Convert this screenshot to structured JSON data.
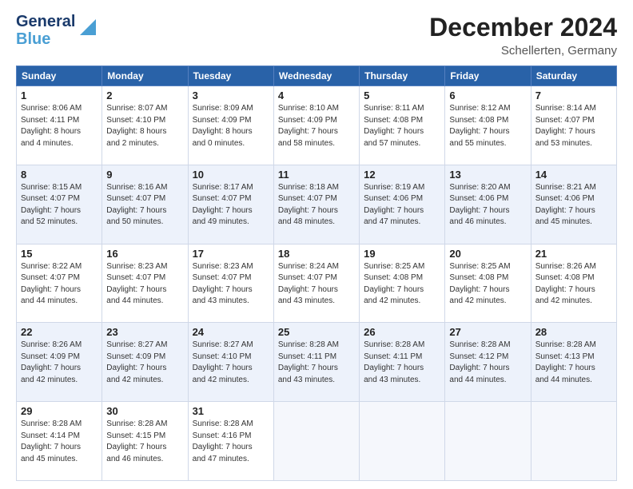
{
  "logo": {
    "line1": "General",
    "line2": "Blue"
  },
  "title": "December 2024",
  "subtitle": "Schellerten, Germany",
  "days_of_week": [
    "Sunday",
    "Monday",
    "Tuesday",
    "Wednesday",
    "Thursday",
    "Friday",
    "Saturday"
  ],
  "weeks": [
    [
      {
        "day": "1",
        "info": "Sunrise: 8:06 AM\nSunset: 4:11 PM\nDaylight: 8 hours\nand 4 minutes."
      },
      {
        "day": "2",
        "info": "Sunrise: 8:07 AM\nSunset: 4:10 PM\nDaylight: 8 hours\nand 2 minutes."
      },
      {
        "day": "3",
        "info": "Sunrise: 8:09 AM\nSunset: 4:09 PM\nDaylight: 8 hours\nand 0 minutes."
      },
      {
        "day": "4",
        "info": "Sunrise: 8:10 AM\nSunset: 4:09 PM\nDaylight: 7 hours\nand 58 minutes."
      },
      {
        "day": "5",
        "info": "Sunrise: 8:11 AM\nSunset: 4:08 PM\nDaylight: 7 hours\nand 57 minutes."
      },
      {
        "day": "6",
        "info": "Sunrise: 8:12 AM\nSunset: 4:08 PM\nDaylight: 7 hours\nand 55 minutes."
      },
      {
        "day": "7",
        "info": "Sunrise: 8:14 AM\nSunset: 4:07 PM\nDaylight: 7 hours\nand 53 minutes."
      }
    ],
    [
      {
        "day": "8",
        "info": "Sunrise: 8:15 AM\nSunset: 4:07 PM\nDaylight: 7 hours\nand 52 minutes."
      },
      {
        "day": "9",
        "info": "Sunrise: 8:16 AM\nSunset: 4:07 PM\nDaylight: 7 hours\nand 50 minutes."
      },
      {
        "day": "10",
        "info": "Sunrise: 8:17 AM\nSunset: 4:07 PM\nDaylight: 7 hours\nand 49 minutes."
      },
      {
        "day": "11",
        "info": "Sunrise: 8:18 AM\nSunset: 4:07 PM\nDaylight: 7 hours\nand 48 minutes."
      },
      {
        "day": "12",
        "info": "Sunrise: 8:19 AM\nSunset: 4:06 PM\nDaylight: 7 hours\nand 47 minutes."
      },
      {
        "day": "13",
        "info": "Sunrise: 8:20 AM\nSunset: 4:06 PM\nDaylight: 7 hours\nand 46 minutes."
      },
      {
        "day": "14",
        "info": "Sunrise: 8:21 AM\nSunset: 4:06 PM\nDaylight: 7 hours\nand 45 minutes."
      }
    ],
    [
      {
        "day": "15",
        "info": "Sunrise: 8:22 AM\nSunset: 4:07 PM\nDaylight: 7 hours\nand 44 minutes."
      },
      {
        "day": "16",
        "info": "Sunrise: 8:23 AM\nSunset: 4:07 PM\nDaylight: 7 hours\nand 44 minutes."
      },
      {
        "day": "17",
        "info": "Sunrise: 8:23 AM\nSunset: 4:07 PM\nDaylight: 7 hours\nand 43 minutes."
      },
      {
        "day": "18",
        "info": "Sunrise: 8:24 AM\nSunset: 4:07 PM\nDaylight: 7 hours\nand 43 minutes."
      },
      {
        "day": "19",
        "info": "Sunrise: 8:25 AM\nSunset: 4:08 PM\nDaylight: 7 hours\nand 42 minutes."
      },
      {
        "day": "20",
        "info": "Sunrise: 8:25 AM\nSunset: 4:08 PM\nDaylight: 7 hours\nand 42 minutes."
      },
      {
        "day": "21",
        "info": "Sunrise: 8:26 AM\nSunset: 4:08 PM\nDaylight: 7 hours\nand 42 minutes."
      }
    ],
    [
      {
        "day": "22",
        "info": "Sunrise: 8:26 AM\nSunset: 4:09 PM\nDaylight: 7 hours\nand 42 minutes."
      },
      {
        "day": "23",
        "info": "Sunrise: 8:27 AM\nSunset: 4:09 PM\nDaylight: 7 hours\nand 42 minutes."
      },
      {
        "day": "24",
        "info": "Sunrise: 8:27 AM\nSunset: 4:10 PM\nDaylight: 7 hours\nand 42 minutes."
      },
      {
        "day": "25",
        "info": "Sunrise: 8:28 AM\nSunset: 4:11 PM\nDaylight: 7 hours\nand 43 minutes."
      },
      {
        "day": "26",
        "info": "Sunrise: 8:28 AM\nSunset: 4:11 PM\nDaylight: 7 hours\nand 43 minutes."
      },
      {
        "day": "27",
        "info": "Sunrise: 8:28 AM\nSunset: 4:12 PM\nDaylight: 7 hours\nand 44 minutes."
      },
      {
        "day": "28",
        "info": "Sunrise: 8:28 AM\nSunset: 4:13 PM\nDaylight: 7 hours\nand 44 minutes."
      }
    ],
    [
      {
        "day": "29",
        "info": "Sunrise: 8:28 AM\nSunset: 4:14 PM\nDaylight: 7 hours\nand 45 minutes."
      },
      {
        "day": "30",
        "info": "Sunrise: 8:28 AM\nSunset: 4:15 PM\nDaylight: 7 hours\nand 46 minutes."
      },
      {
        "day": "31",
        "info": "Sunrise: 8:28 AM\nSunset: 4:16 PM\nDaylight: 7 hours\nand 47 minutes."
      },
      null,
      null,
      null,
      null
    ]
  ]
}
